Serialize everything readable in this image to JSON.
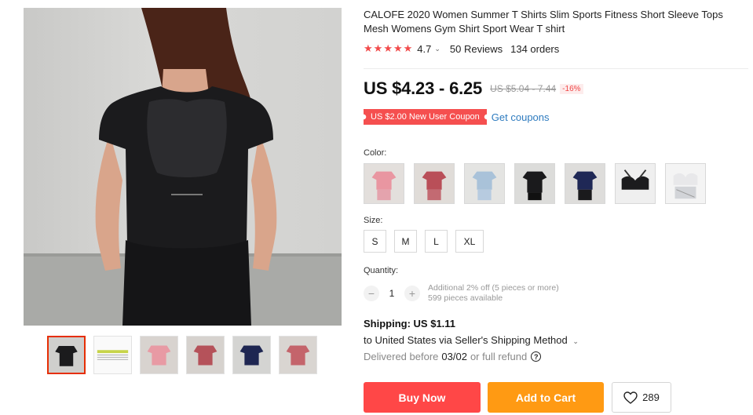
{
  "product": {
    "title": "CALOFE 2020 Women Summer T Shirts Slim Sports Fitness Short Sleeve Tops Mesh Womens Gym Shirt Sport Wear T shirt",
    "rating": "4.7",
    "reviews": "50 Reviews",
    "orders": "134 orders"
  },
  "price": {
    "current": "US $4.23 - 6.25",
    "original": "US $5.04 - 7.44",
    "discount": "-16%"
  },
  "coupon": {
    "label": "US $2.00 New User Coupon",
    "link": "Get coupons"
  },
  "color": {
    "label": "Color:",
    "options": [
      {
        "name": "pink",
        "icon": "pink-shirt"
      },
      {
        "name": "red",
        "icon": "red-shirt"
      },
      {
        "name": "light blue",
        "icon": "blue-shirt"
      },
      {
        "name": "black",
        "icon": "black-shirt"
      },
      {
        "name": "navy",
        "icon": "navy-shirt"
      },
      {
        "name": "black bra",
        "icon": "bra"
      },
      {
        "name": "white set",
        "icon": "white-set"
      }
    ]
  },
  "size": {
    "label": "Size:",
    "options": [
      "S",
      "M",
      "L",
      "XL"
    ]
  },
  "quantity": {
    "label": "Quantity:",
    "minus": "−",
    "plus": "+",
    "value": "1",
    "promo": "Additional 2% off (5 pieces or more)",
    "available": "599 pieces available"
  },
  "shipping": {
    "title": "Shipping: US $1.11",
    "to": "to United States via Seller's Shipping Method",
    "delivered_prefix": "Delivered before",
    "date": "03/02",
    "refund": "or full refund",
    "help": "?"
  },
  "actions": {
    "buy_now": "Buy Now",
    "add_to_cart": "Add to Cart",
    "wishlist_count": "289"
  },
  "colors": {
    "accent_red": "#ff4747",
    "accent_orange": "#ff9a13",
    "star": "#f24a4a",
    "link": "#2e7bbf"
  }
}
